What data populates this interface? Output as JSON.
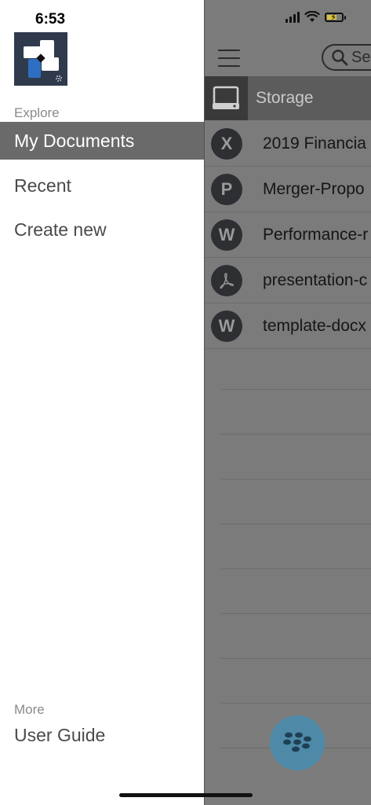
{
  "status_bar": {
    "time": "6:53"
  },
  "drawer": {
    "sections": {
      "explore_label": "Explore",
      "more_label": "More"
    },
    "items": [
      {
        "label": "My Documents",
        "active": true
      },
      {
        "label": "Recent",
        "active": false
      },
      {
        "label": "Create new",
        "active": false
      }
    ],
    "more_items": [
      {
        "label": "User Guide"
      }
    ]
  },
  "background": {
    "search_placeholder": "Se",
    "location_label": "Storage",
    "files": [
      {
        "type_letter": "X",
        "name": "2019 Financia",
        "icon": "excel-icon"
      },
      {
        "type_letter": "P",
        "name": "Merger-Propo",
        "icon": "powerpoint-icon"
      },
      {
        "type_letter": "W",
        "name": "Performance-r",
        "icon": "word-icon"
      },
      {
        "type_letter": "",
        "name": "presentation-c",
        "icon": "pdf-icon"
      },
      {
        "type_letter": "W",
        "name": "template-docx",
        "icon": "word-icon"
      }
    ]
  },
  "colors": {
    "active_item_bg": "#6a6a6a",
    "overlay": "#7b7b7b",
    "fab": "#4e8aa8"
  }
}
